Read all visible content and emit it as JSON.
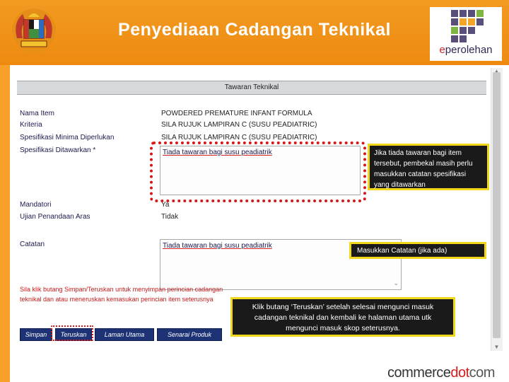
{
  "header": {
    "title": "Penyediaan Cadangan Teknikal",
    "logo_text_prefix": "e",
    "logo_text_main": "perolehan"
  },
  "form": {
    "section_title": "Tawaran Teknikal",
    "fields": [
      {
        "label": "Nama Item",
        "value": "POWDERED PREMATURE INFANT FORMULA"
      },
      {
        "label": "Kriteria",
        "value": "SILA RUJUK LAMPIRAN C (SUSU PEADIATRIC)"
      },
      {
        "label": "Spesifikasi Minima Diperlukan",
        "value": "SILA RUJUK LAMPIRAN C (SUSU PEADIATRIC)"
      },
      {
        "label": "Spesifikasi Ditawarkan *",
        "value": ""
      },
      {
        "label": "Mandatori",
        "value": "Ya"
      },
      {
        "label": "Ujian Penandaan Aras",
        "value": "Tidak"
      },
      {
        "label": "Catatan",
        "value": ""
      }
    ],
    "spec_offered_text": "Tiada tawaran bagi susu peadiatrik",
    "catatan_text": "Tiada tawaran bagi susu peadiatrik",
    "instruction_line1": "Sila klik butang Simpan/Teruskan untuk menyimpan perincian cadangan",
    "instruction_line2": "teknikal dan atau meneruskan kemasukan perincian item seterusnya",
    "buttons": [
      "Simpan",
      "Teruskan",
      "Laman Utama",
      "Senarai Produk"
    ]
  },
  "callouts": {
    "spec": "Jika tiada tawaran bagi item tersebut, pembekal masih perlu masukkan catatan spesifikasi yang ditawarkan",
    "catatan": "Masukkan Catatan (jika ada)",
    "teruskan": "Klik butang ‘Teruskan’ setelah selesai mengunci masuk cadangan teknikal dan kembali ke halaman utama utk mengunci masuk skop seterusnya."
  },
  "footer": {
    "brand_part1": "commerce",
    "brand_part2": "dot",
    "brand_part3": "com"
  },
  "colors": {
    "header_orange": "#f29a22",
    "button_navy": "#1e3376",
    "callout_border_yellow": "#f1d61b",
    "highlight_red": "#d81818"
  }
}
